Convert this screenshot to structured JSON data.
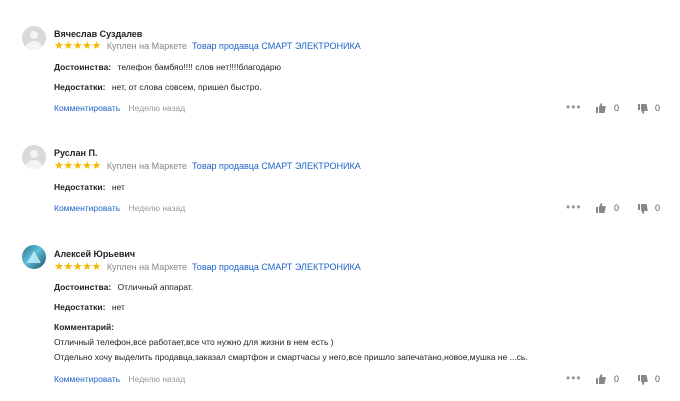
{
  "reviews": [
    {
      "author": "Вячеслав Суздалев",
      "stars": "★★★★★",
      "bought": "Куплен на Маркете",
      "seller": "Товар продавца СМАРТ ЭЛЕКТРОНИКА",
      "pros_label": "Достоинства:",
      "pros": "телефон бамбяо!!!! слов нет!!!!благодарю",
      "cons_label": "Недостатки:",
      "cons": "нет, от слова совсем, пришел быстро.",
      "comment_link": "Комментировать",
      "when": "Неделю назад",
      "likes": "0",
      "dislikes": "0"
    },
    {
      "author": "Руслан П.",
      "stars": "★★★★★",
      "bought": "Куплен на Маркете",
      "seller": "Товар продавца СМАРТ ЭЛЕКТРОНИКА",
      "cons_label": "Недостатки:",
      "cons": "нет",
      "comment_link": "Комментировать",
      "when": "Неделю назад",
      "likes": "0",
      "dislikes": "0"
    },
    {
      "author": "Алексей Юрьевич",
      "stars": "★★★★★",
      "bought": "Куплен на Маркете",
      "seller": "Товар продавца СМАРТ ЭЛЕКТРОНИКА",
      "pros_label": "Достоинства:",
      "pros": "Отличный аппарат.",
      "cons_label": "Недостатки:",
      "cons": "нет",
      "comment_label": "Комментарий:",
      "comment_line1": "Отличный телефон,все работает,все что нужно для жизни в нем есть )",
      "comment_line2": "Отдельно хочу выделить продавца,заказал смартфон и смартчасы у него,все пришло запечатано,новое,мушка не ...сь.",
      "comment_link": "Комментировать",
      "when": "Неделю назад",
      "likes": "0",
      "dislikes": "0"
    }
  ],
  "icons": {
    "like": "thumb-up-icon",
    "dislike": "thumb-down-icon",
    "more": "more-dots-icon"
  },
  "colors": {
    "link": "#1e64c8",
    "star": "#f5b800",
    "muted": "#888888"
  }
}
